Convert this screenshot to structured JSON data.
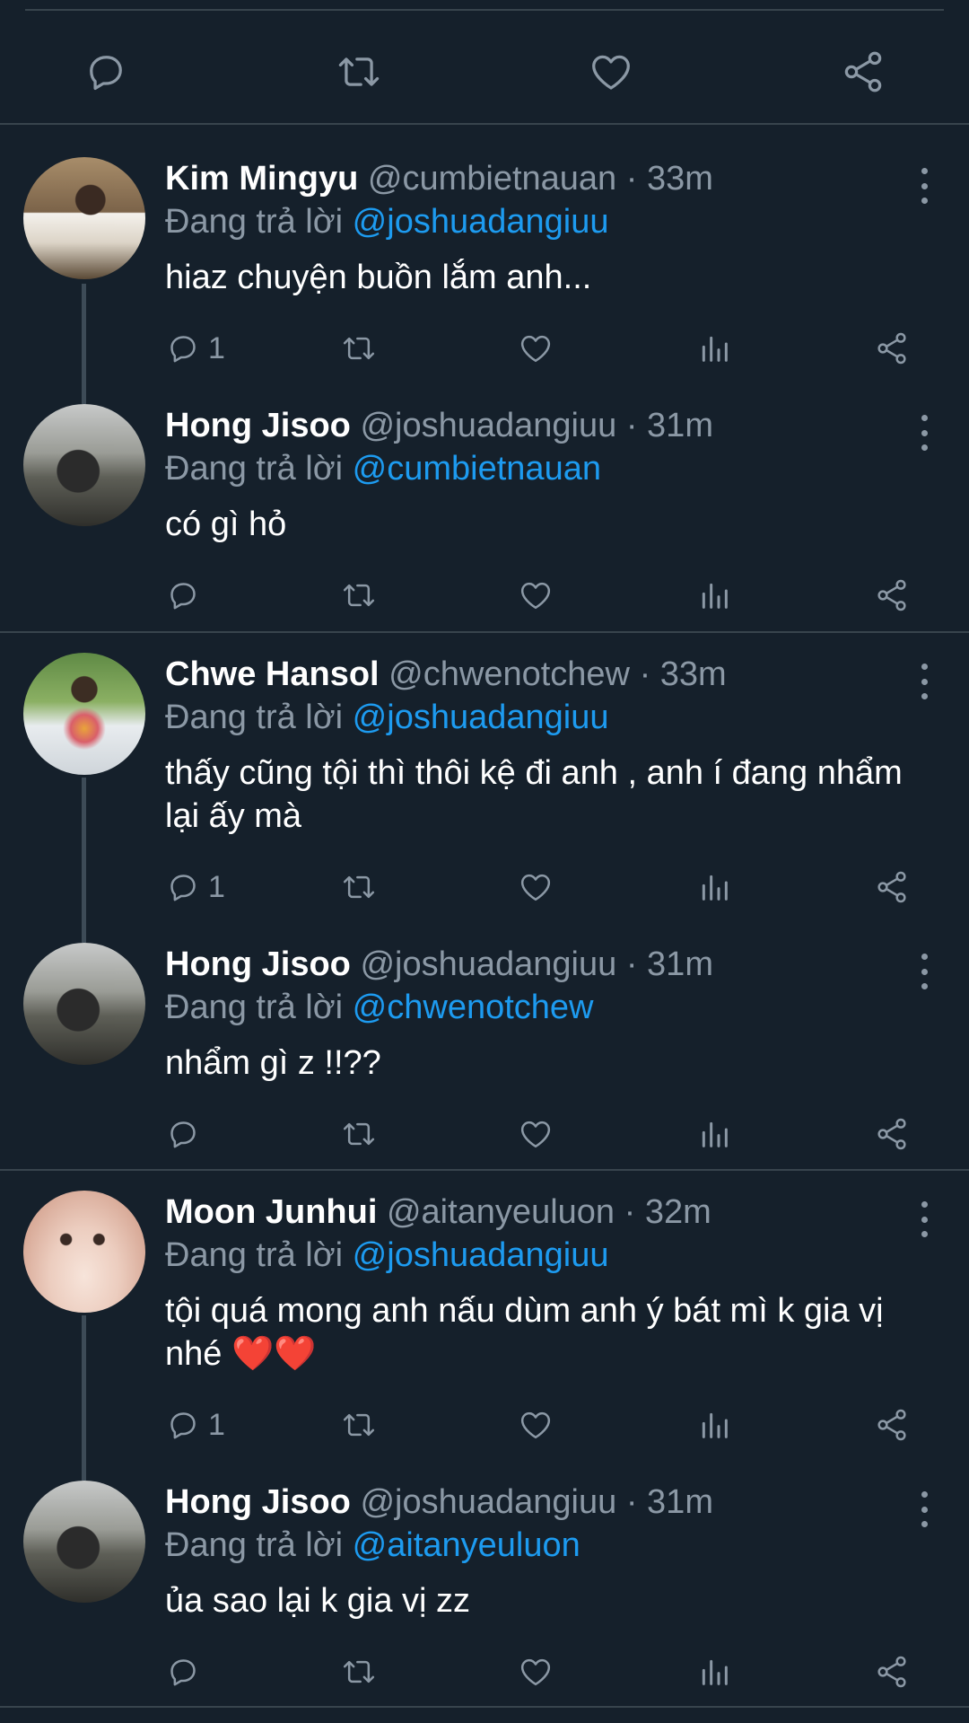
{
  "ui": {
    "accent": "#1d9bf0",
    "background": "#15202b",
    "muted": "#8b98a5"
  },
  "icons": [
    "reply-icon",
    "retweet-icon",
    "like-icon",
    "share-icon",
    "analytics-icon",
    "more-icon"
  ],
  "tweets": [
    {
      "name": "Kim Mingyu",
      "handle": "@cumbietnauan",
      "sep": "·",
      "time": "33m",
      "reply_prefix": "Đang trả lời",
      "reply_to": "@joshuadangiuu",
      "text": "hiaz chuyện buồn lắm anh...",
      "reply_count": "1"
    },
    {
      "name": "Hong Jisoo",
      "handle": "@joshuadangiuu",
      "sep": "·",
      "time": "31m",
      "reply_prefix": "Đang trả lời",
      "reply_to": "@cumbietnauan",
      "text": "có gì hỏ",
      "reply_count": ""
    },
    {
      "name": "Chwe Hansol",
      "handle": "@chwenotchew",
      "sep": "·",
      "time": "33m",
      "reply_prefix": "Đang trả lời",
      "reply_to": "@joshuadangiuu",
      "text": "thấy cũng tội thì thôi kệ đi anh , anh í đang nhẩm lại ấy mà",
      "reply_count": "1"
    },
    {
      "name": "Hong Jisoo",
      "handle": "@joshuadangiuu",
      "sep": "·",
      "time": "31m",
      "reply_prefix": "Đang trả lời",
      "reply_to": "@chwenotchew",
      "text": "nhẩm gì z !!??",
      "reply_count": ""
    },
    {
      "name": "Moon Junhui",
      "handle": "@aitanyeuluon",
      "sep": "·",
      "time": "32m",
      "reply_prefix": "Đang trả lời",
      "reply_to": "@joshuadangiuu",
      "text": "tội quá mong anh nấu dùm anh ý bát mì k gia vị nhé ❤️❤️",
      "reply_count": "1"
    },
    {
      "name": "Hong Jisoo",
      "handle": "@joshuadangiuu",
      "sep": "·",
      "time": "31m",
      "reply_prefix": "Đang trả lời",
      "reply_to": "@aitanyeuluon",
      "text": "ủa sao lại k gia vị zz",
      "reply_count": ""
    }
  ]
}
